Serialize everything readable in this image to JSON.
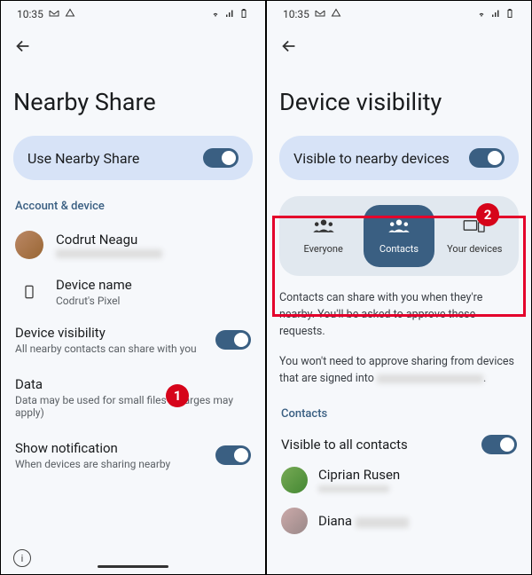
{
  "status": {
    "time": "10:35",
    "wifi_icon": "wifi",
    "signal_icon": "signal",
    "battery_icon": "battery"
  },
  "left": {
    "title": "Nearby Share",
    "toggle_label": "Use Nearby Share",
    "section1": "Account & device",
    "account_name": "Codrut Neagu",
    "device_label": "Device name",
    "device_value": "Codrut's Pixel",
    "visibility_title": "Device visibility",
    "visibility_sub": "All nearby contacts can share with you",
    "data_title": "Data",
    "data_sub": "Data may be used for small files (charges may apply)",
    "notif_title": "Show notification",
    "notif_sub": "When devices are sharing nearby"
  },
  "right": {
    "title": "Device visibility",
    "toggle_label": "Visible to nearby devices",
    "opt_everyone": "Everyone",
    "opt_contacts": "Contacts",
    "opt_devices": "Your devices",
    "desc1": "Contacts can share with you when they're nearby. You'll be asked to approve these requests.",
    "desc2_prefix": "You won't need to approve sharing from devices that are signed into ",
    "contacts_header": "Contacts",
    "visible_all": "Visible to all contacts",
    "contact1": "Ciprian Rusen",
    "contact2_prefix": "Diana "
  },
  "callouts": {
    "one": "1",
    "two": "2"
  }
}
